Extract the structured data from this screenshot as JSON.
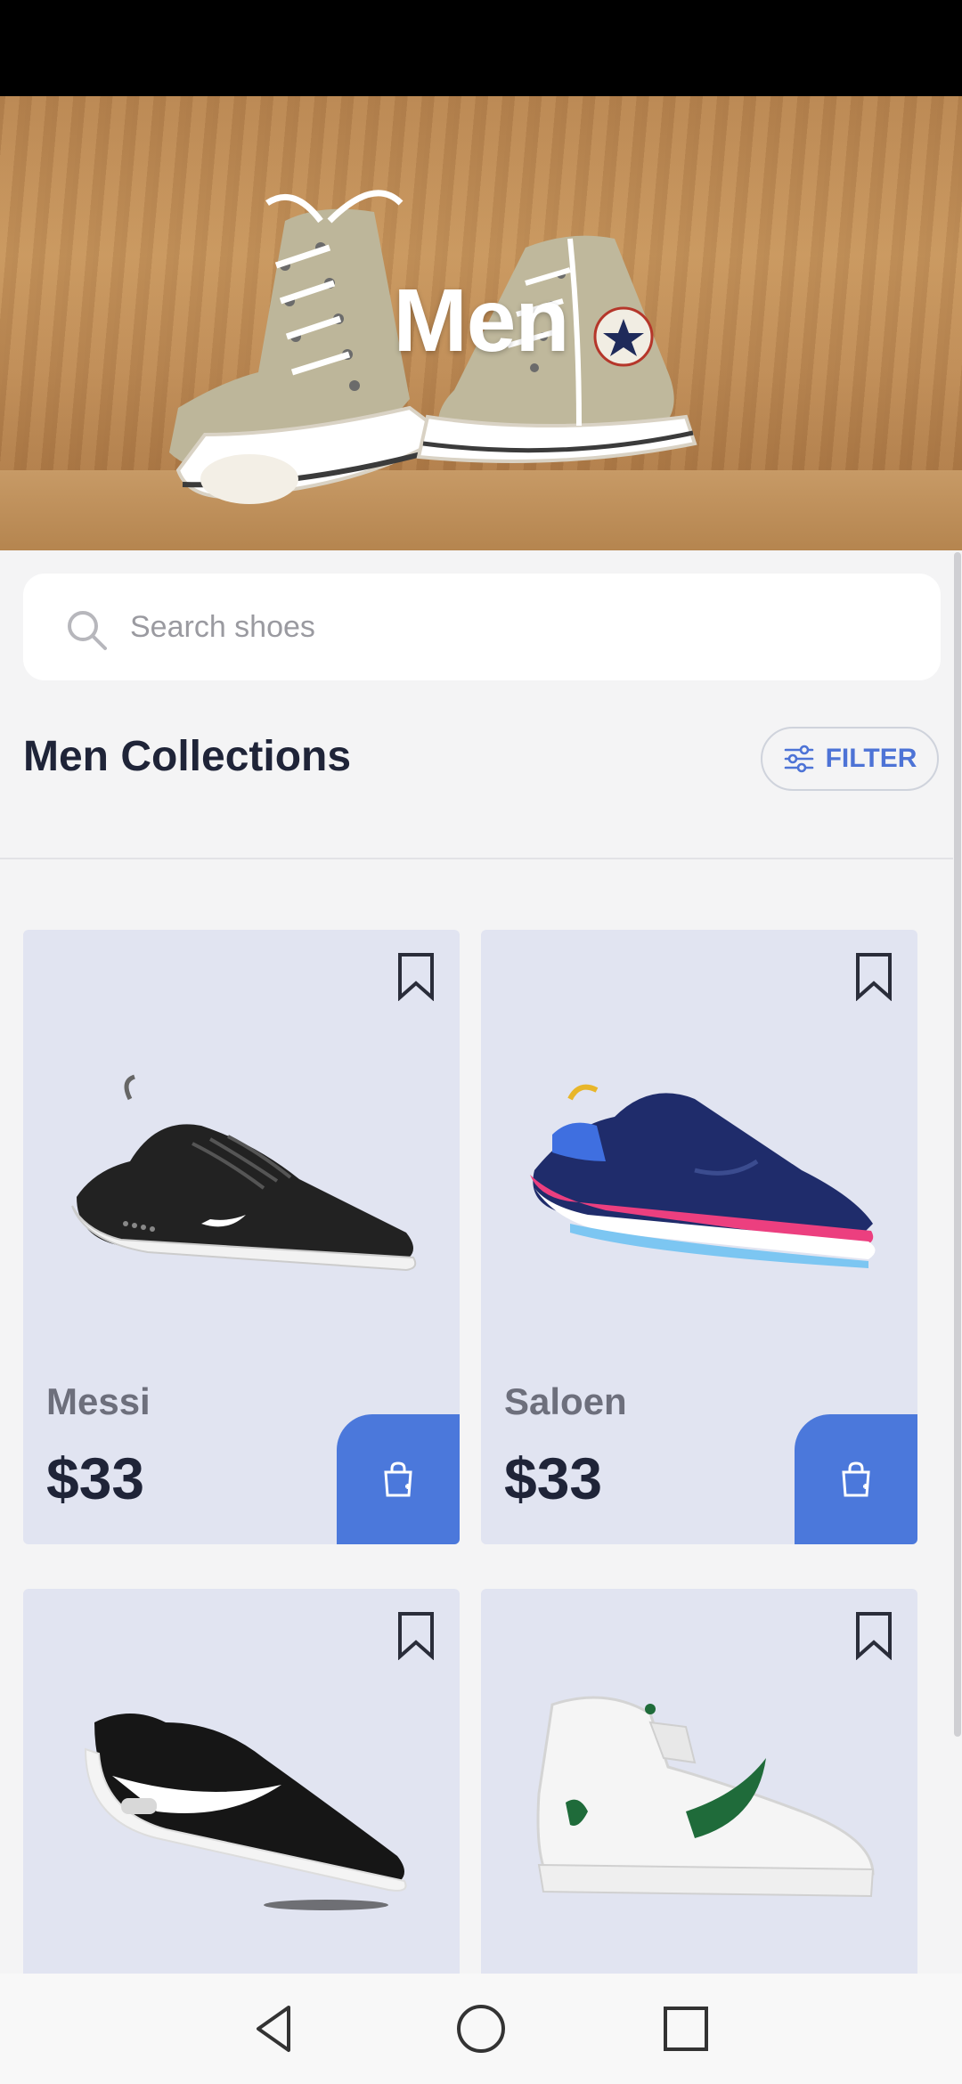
{
  "hero": {
    "title": "Men"
  },
  "search": {
    "placeholder": "Search shoes",
    "value": ""
  },
  "section": {
    "title": "Men Collections",
    "filter_label": "FILTER"
  },
  "products": [
    {
      "name": "Messi",
      "price": "$33",
      "bookmarked": false
    },
    {
      "name": "Saloen",
      "price": "$33",
      "bookmarked": false
    },
    {
      "name": "",
      "price": "",
      "bookmarked": false
    },
    {
      "name": "",
      "price": "",
      "bookmarked": false
    }
  ],
  "colors": {
    "accent": "#4b78db",
    "card_background": "#e1e4f1",
    "heading": "#1f2438",
    "product_name": "#6d6f7c",
    "page_background": "#f4f4f5"
  },
  "icons": {
    "search": "search-icon",
    "filter": "sliders-icon",
    "bookmark": "bookmark-icon",
    "cart": "shopping-bag-icon",
    "nav_back": "triangle-back-icon",
    "nav_home": "circle-home-icon",
    "nav_recents": "square-recents-icon"
  }
}
